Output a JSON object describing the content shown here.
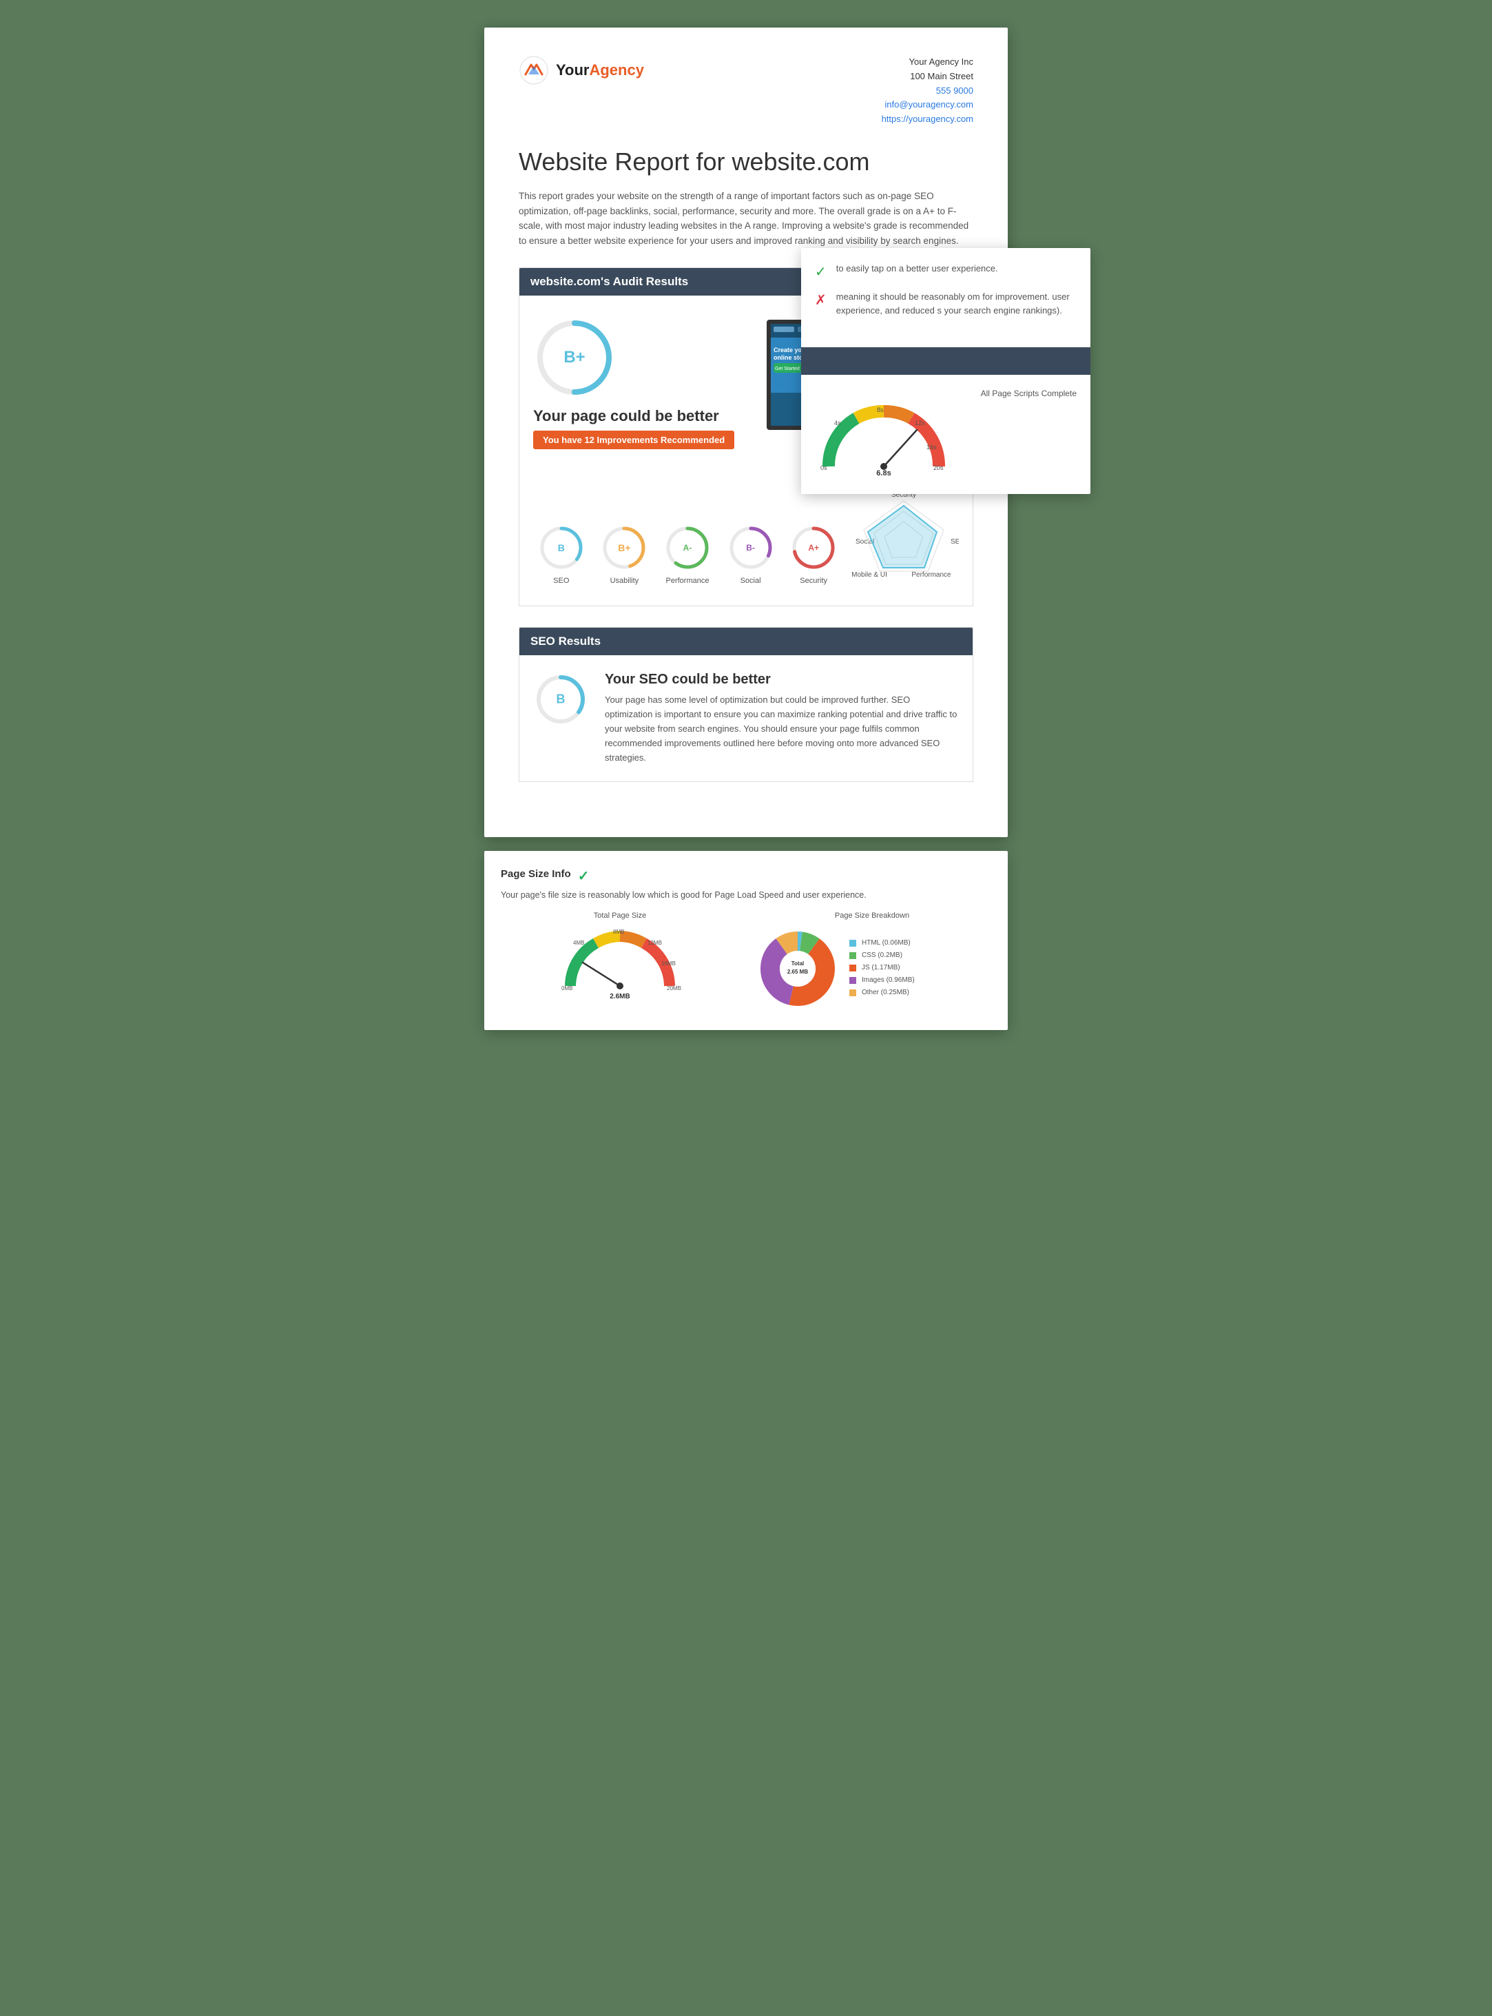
{
  "agency": {
    "name_part1": "Your",
    "name_part2": "Agency",
    "company": "Your Agency Inc",
    "address": "100 Main Street",
    "phone": "555 9000",
    "email": "info@youragency.com",
    "website": "https://youragency.com"
  },
  "report": {
    "title": "Website Report for website.com",
    "description": "This report grades your website on the strength of a range of important factors such as on-page SEO optimization, off-page backlinks, social, performance, security and more. The overall grade is on a A+ to F-scale, with most major industry leading websites in the A range. Improving a website's grade is recommended to ensure a better website experience for your users and improved ranking and visibility by search engines."
  },
  "audit": {
    "section_title": "website.com's Audit Results",
    "overall_grade": "B+",
    "page_title": "Your page could be better",
    "improvements_badge": "You have 12 Improvements Recommended",
    "sub_grades": [
      {
        "label": "B",
        "name": "SEO",
        "color": "#5bc0de"
      },
      {
        "label": "B+",
        "name": "Usability",
        "color": "#f0ad4e"
      },
      {
        "label": "A-",
        "name": "Performance",
        "color": "#5cb85c"
      },
      {
        "label": "B-",
        "name": "Social",
        "color": "#9b59b6"
      },
      {
        "label": "A+",
        "name": "Security",
        "color": "#d9534f"
      }
    ]
  },
  "spider_chart": {
    "labels": [
      "Security",
      "SEO",
      "Performance",
      "Mobile & UI",
      "Social"
    ]
  },
  "seo": {
    "section_title": "SEO Results",
    "grade": "B",
    "title": "Your SEO could be better",
    "description": "Your page has some level of optimization but could be improved further. SEO optimization is important to ensure you can maximize ranking potential and drive traffic to your website from search engines. You should ensure your page fulfils common recommended improvements outlined here before moving onto more advanced SEO strategies."
  },
  "overlay": {
    "check1_text": "to easily tap on a better user experience.",
    "check2_text": "meaning it should be reasonably om for improvement. user experience, and reduced s your search engine rankings).",
    "speed_label": "All Page Scripts Complete",
    "speed_value": "6.8s",
    "page_size_title": "Page Size Info",
    "page_size_desc": "Your page's file size is reasonably low which is good for Page Load Speed and user experience."
  },
  "gauge": {
    "value": "2.6MB",
    "labels": [
      "0MB",
      "4MB",
      "8MB",
      "12MB",
      "16MB",
      "20MB"
    ],
    "needle_angle": 130
  },
  "donut": {
    "total_label": "Total 2.65 MB",
    "segments": [
      {
        "label": "HTML (0.06MB)",
        "color": "#5bc0de",
        "pct": 2
      },
      {
        "label": "CSS (0.2MB)",
        "color": "#5cb85c",
        "pct": 8
      },
      {
        "label": "JS (1.17MB)",
        "color": "#e85d26",
        "pct": 44
      },
      {
        "label": "Images (0.96MB)",
        "color": "#9b59b6",
        "pct": 36
      },
      {
        "label": "Other (0.25MB)",
        "color": "#f0ad4e",
        "pct": 10
      }
    ]
  },
  "speed_gauge": {
    "value": "6.8s",
    "labels": [
      "4s",
      "8s",
      "12s",
      "16s",
      "20s"
    ],
    "needle_angle": 145
  }
}
